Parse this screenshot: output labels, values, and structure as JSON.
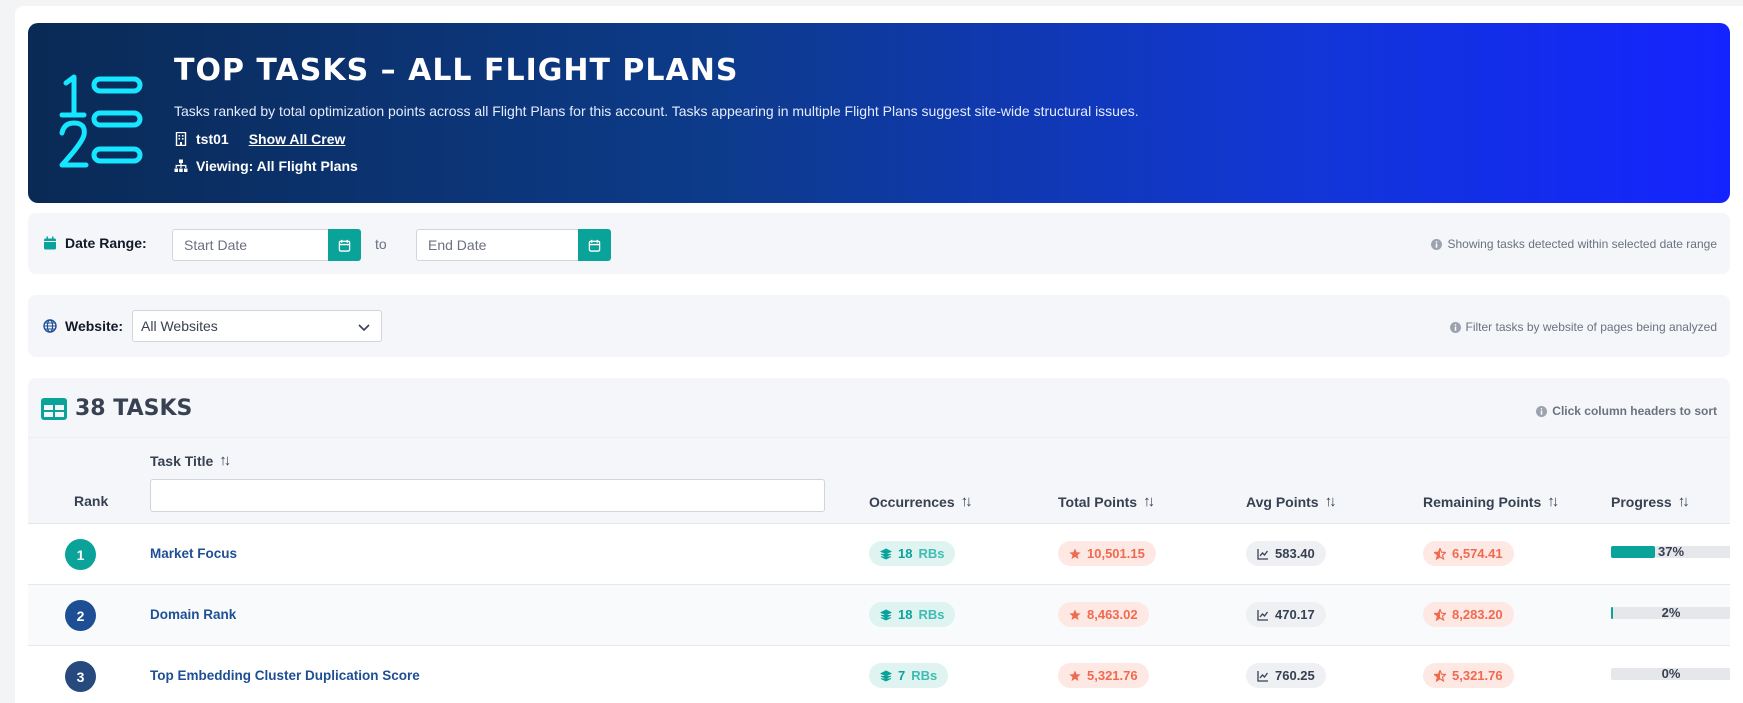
{
  "header": {
    "title": "Top Tasks – All Flight Plans",
    "description": "Tasks ranked by total optimization points across all Flight Plans for this account. Tasks appearing in multiple Flight Plans suggest site-wide structural issues.",
    "account": "tst01",
    "crew_link": "Show All Crew",
    "viewing": "Viewing: All Flight Plans"
  },
  "date_filter": {
    "label": "Date Range:",
    "start_placeholder": "Start Date",
    "separator": "to",
    "end_placeholder": "End Date",
    "hint": "Showing tasks detected within selected date range"
  },
  "website_filter": {
    "label": "Website:",
    "selected": "All Websites",
    "hint": "Filter tasks by website of pages being analyzed"
  },
  "tasks_panel": {
    "title": "38 Tasks",
    "hint": "Click column headers to sort",
    "columns": {
      "rank": "Rank",
      "task_title": "Task Title",
      "occurrences": "Occurrences",
      "total_points": "Total Points",
      "avg_points": "Avg Points",
      "remaining_points": "Remaining Points",
      "progress": "Progress"
    },
    "rows": [
      {
        "rank": "1",
        "title": "Market Focus",
        "occurrences": "18",
        "occ_unit": "RBs",
        "total": "10,501.15",
        "avg": "583.40",
        "remaining": "6,574.41",
        "progress_label": "37%",
        "progress": 37,
        "rank_color": "#0aa39a"
      },
      {
        "rank": "2",
        "title": "Domain Rank",
        "occurrences": "18",
        "occ_unit": "RBs",
        "total": "8,463.02",
        "avg": "470.17",
        "remaining": "8,283.20",
        "progress_label": "2%",
        "progress": 2,
        "rank_color": "#1e4f95"
      },
      {
        "rank": "3",
        "title": "Top Embedding Cluster Duplication Score",
        "occurrences": "7",
        "occ_unit": "RBs",
        "total": "5,321.76",
        "avg": "760.25",
        "remaining": "5,321.76",
        "progress_label": "0%",
        "progress": 0,
        "rank_color": "#274a7e"
      }
    ]
  },
  "colors": {
    "accent": "#0aa39a",
    "link": "#1e4f95",
    "points": "#f06a4f"
  },
  "icons": {
    "header": "numbered-list-icon",
    "account": "building-icon",
    "viewing": "sitemap-icon",
    "date": "calendar-icon",
    "website": "globe-icon",
    "tasks": "table-icon",
    "hint": "info-icon",
    "occurrences": "layers-icon",
    "total": "star-icon",
    "avg": "chart-line-icon",
    "remaining": "star-half-icon",
    "select": "chevron-down-icon"
  }
}
